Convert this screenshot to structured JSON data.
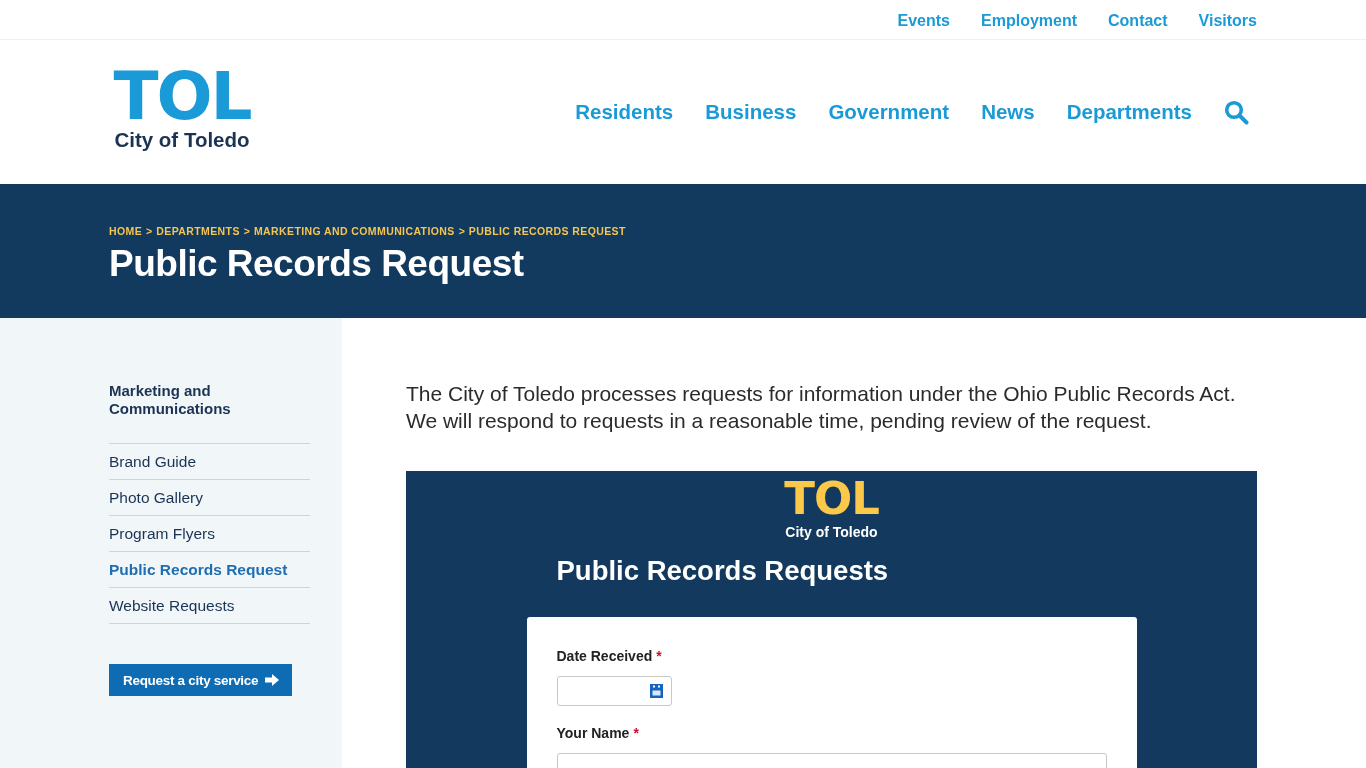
{
  "utility_nav": [
    {
      "label": "Events"
    },
    {
      "label": "Employment"
    },
    {
      "label": "Contact"
    },
    {
      "label": "Visitors"
    }
  ],
  "logo": {
    "mark": "TOL",
    "name": "City of Toledo"
  },
  "main_nav": [
    {
      "label": "Residents"
    },
    {
      "label": "Business"
    },
    {
      "label": "Government"
    },
    {
      "label": "News"
    },
    {
      "label": "Departments"
    }
  ],
  "page_header": {
    "breadcrumb": {
      "separator": ">",
      "items": [
        "HOME",
        "DEPARTMENTS",
        "MARKETING AND COMMUNICATIONS",
        "PUBLIC RECORDS REQUEST"
      ]
    },
    "title": "Public Records Request"
  },
  "sidebar": {
    "heading": "Marketing and Communications",
    "items": [
      {
        "label": "Brand Guide",
        "selected": false
      },
      {
        "label": "Photo Gallery",
        "selected": false
      },
      {
        "label": "Program Flyers",
        "selected": false
      },
      {
        "label": "Public Records Request",
        "selected": true
      },
      {
        "label": "Website Requests",
        "selected": false
      }
    ],
    "cta": "Request a city service"
  },
  "intro": "The City of Toledo processes requests for information under the Ohio Public Records Act. We will respond to requests in a reasonable time, pending review of the request.",
  "form": {
    "logo": {
      "mark": "TOL",
      "name": "City of Toledo"
    },
    "title": "Public Records Requests",
    "fields": [
      {
        "label": "Date Received",
        "required_mark": "*",
        "kind": "date"
      },
      {
        "label": "Your Name",
        "required_mark": "*",
        "kind": "text"
      }
    ]
  }
}
